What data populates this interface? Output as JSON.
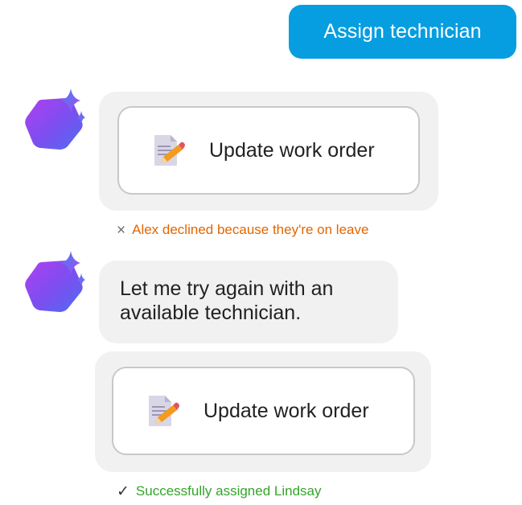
{
  "user_message": {
    "text": "Assign technician",
    "bg_color": "#069ee0",
    "text_color": "#ffffff"
  },
  "assistant": {
    "avatar_icon": "sparkle-hexagon-avatar-icon",
    "avatar_colors": [
      "#9f3ff3",
      "#5c63ee",
      "#e060c8"
    ]
  },
  "turn_1": {
    "tool_call": {
      "icon": "document-edit-icon",
      "label": "Update work order"
    },
    "status": {
      "icon": "×",
      "icon_name": "close-icon",
      "text": "Alex declined because they're on leave",
      "color": "#e36500"
    }
  },
  "turn_2": {
    "message": "Let me try again with an available technician.",
    "tool_call": {
      "icon": "document-edit-icon",
      "label": "Update work order"
    },
    "status": {
      "icon": "✓",
      "icon_name": "checkmark-icon",
      "text": "Successfully assigned Lindsay",
      "color": "#33a52a"
    }
  }
}
